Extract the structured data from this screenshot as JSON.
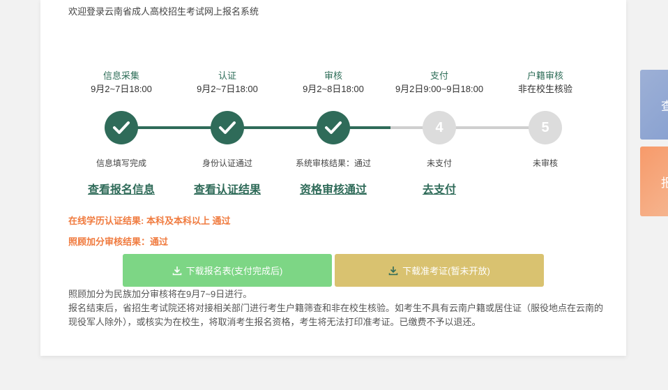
{
  "welcome": "欢迎登录云南省成人高校招生考试网上报名系统",
  "steps": [
    {
      "title": "信息采集",
      "date": "9月2~7日18:00",
      "status": "信息填写完成",
      "link": "查看报名信息",
      "state": "done"
    },
    {
      "title": "认证",
      "date": "9月2~7日18:00",
      "status": "身份认证通过",
      "link": "查看认证结果",
      "state": "done"
    },
    {
      "title": "审核",
      "date": "9月2~8日18:00",
      "status": "系统审核结果：通过",
      "link": "资格审核通过",
      "state": "done"
    },
    {
      "title": "支付",
      "date": "9月2日9:00~9日18:00",
      "status": "未支付",
      "link": "去支付",
      "state": "todo",
      "num": "4"
    },
    {
      "title": "户籍审核",
      "date": "非在校生核验",
      "status": "未审核",
      "link": "",
      "state": "todo",
      "num": "5"
    }
  ],
  "results": {
    "education": "在线学历认证结果: 本科及本科以上 通过",
    "bonus": "照顾加分审核结果：通过"
  },
  "buttons": {
    "download_form": "下载报名表(支付完成后)",
    "download_ticket": "下载准考证(暂未开放)"
  },
  "notes": {
    "line1": "照顾加分为民族加分审核将在9月7~9日进行。",
    "line2": "报名结束后，省招生考试院还将对接相关部门进行考生户籍筛查和非在校生核验。如考生不具有云南户籍或居住证（服役地点在云南的现役军人除外），或核实为在校生，将取消考生报名资格，考生将无法打印准考证。已缴费不予以退还。"
  },
  "side": {
    "first_char": "查",
    "second_char": "报"
  },
  "colors": {
    "accent_green": "#2f6b59",
    "pending_gray": "#dcdcdc",
    "result_orange": "#f07b3f",
    "btn_green": "#7dd685",
    "btn_gold": "#d9c270"
  }
}
